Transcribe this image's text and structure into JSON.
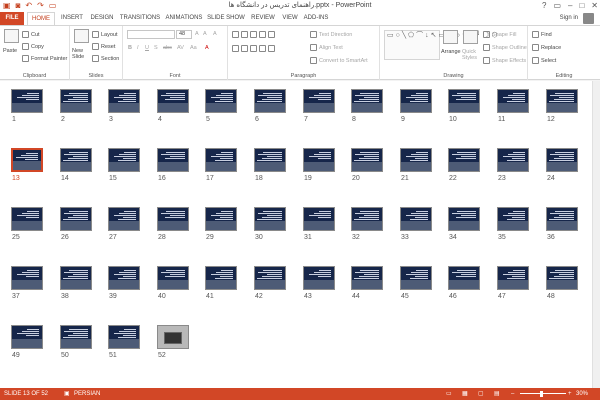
{
  "window": {
    "title": "راهنمای تدریس در دانشگاه ها.pptx - PowerPoint",
    "controls": [
      "?",
      "▭",
      "–",
      "□",
      "✕"
    ]
  },
  "tabs": [
    "FILE",
    "HOME",
    "INSERT",
    "DESIGN",
    "TRANSITIONS",
    "ANIMATIONS",
    "SLIDE SHOW",
    "REVIEW",
    "VIEW",
    "ADD-INS"
  ],
  "active_tab": "HOME",
  "signin": "Sign in",
  "ribbon": {
    "clipboard": {
      "label": "Clipboard",
      "paste": "Paste",
      "cut": "Cut",
      "copy": "Copy",
      "format_painter": "Format Painter"
    },
    "slides": {
      "label": "Slides",
      "new_slide": "New Slide",
      "layout": "Layout",
      "reset": "Reset",
      "section": "Section"
    },
    "font": {
      "label": "Font",
      "size": "48",
      "grow": "A",
      "shrink": "A",
      "clear": "A",
      "bold": "B",
      "italic": "I",
      "underline": "U",
      "shadow": "S",
      "strike": "abc",
      "spacing": "AV",
      "case": "Aa",
      "color": "A"
    },
    "paragraph": {
      "label": "Paragraph",
      "text_direction": "Text Direction",
      "align_text": "Align Text",
      "convert_smartart": "Convert to SmartArt"
    },
    "drawing": {
      "label": "Drawing",
      "arrange": "Arrange",
      "quick_styles": "Quick Styles",
      "shape_fill": "Shape Fill",
      "shape_outline": "Shape Outline",
      "shape_effects": "Shape Effects"
    },
    "editing": {
      "label": "Editing",
      "find": "Find",
      "replace": "Replace",
      "select": "Select"
    }
  },
  "slides": [
    "1",
    "2",
    "3",
    "4",
    "5",
    "6",
    "7",
    "8",
    "9",
    "10",
    "11",
    "12",
    "13",
    "14",
    "15",
    "16",
    "17",
    "18",
    "19",
    "20",
    "21",
    "22",
    "23",
    "24",
    "25",
    "26",
    "27",
    "28",
    "29",
    "30",
    "31",
    "32",
    "33",
    "34",
    "35",
    "36",
    "37",
    "38",
    "39",
    "40",
    "41",
    "42",
    "43",
    "44",
    "45",
    "46",
    "47",
    "48",
    "49",
    "50",
    "51",
    "52"
  ],
  "selected_slide": "13",
  "status": {
    "slide_info": "SLIDE 13 OF 52",
    "language": "PERSIAN",
    "zoom": "30%",
    "zoom_minus": "–",
    "zoom_plus": "+"
  },
  "colors": {
    "accent": "#d24726",
    "thumb_bg": "#16264a"
  }
}
